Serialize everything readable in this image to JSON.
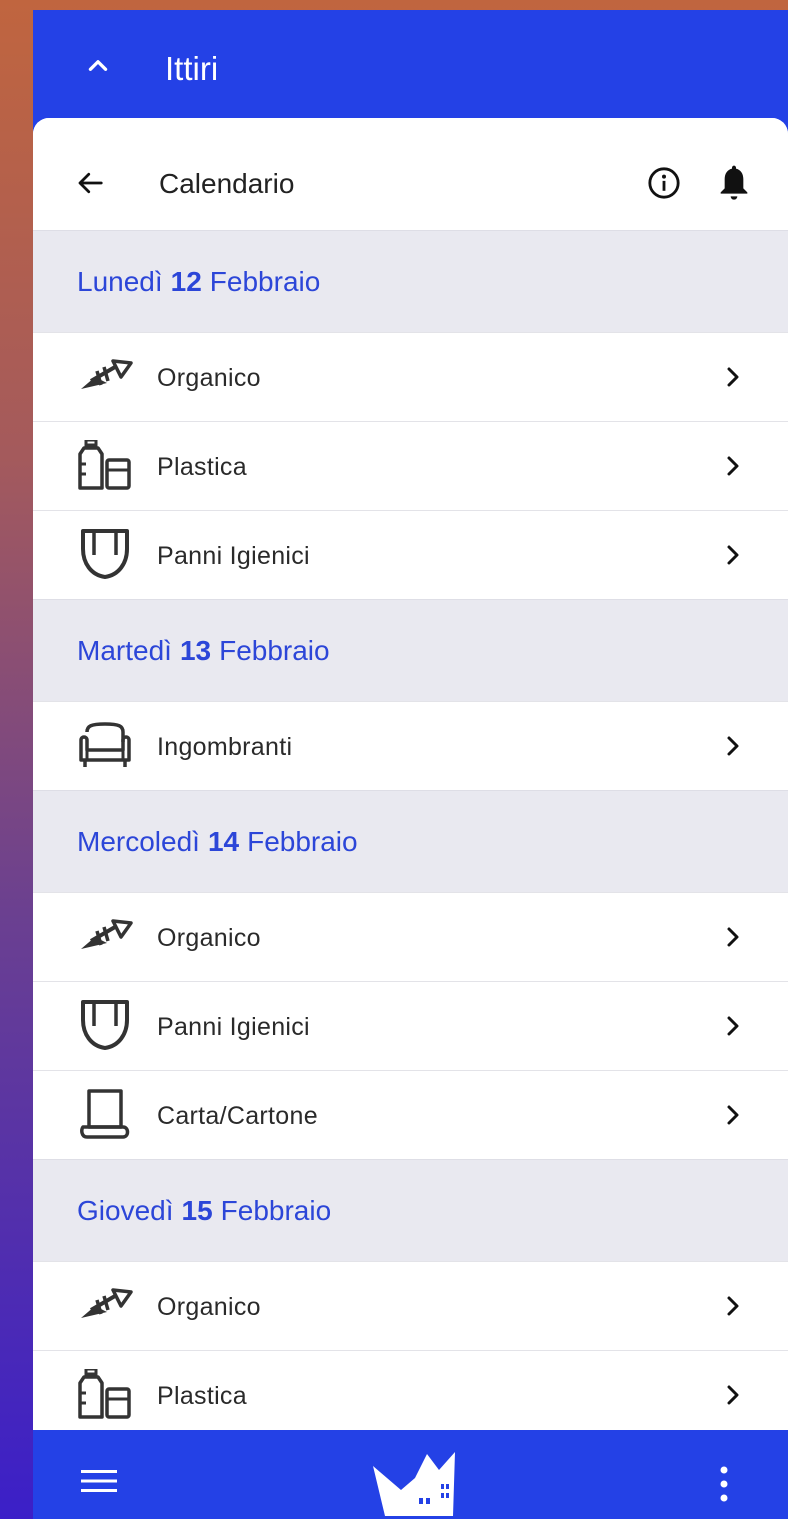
{
  "app": {
    "place_name": "Ittiri"
  },
  "header": {
    "title": "Calendario"
  },
  "days": [
    {
      "weekday": "Lunedì",
      "number": "12",
      "month": "Febbraio",
      "items": [
        {
          "label": "Organico",
          "icon": "fish-bone-icon"
        },
        {
          "label": "Plastica",
          "icon": "plastic-bottle-icon"
        },
        {
          "label": "Panni Igienici",
          "icon": "diaper-icon"
        }
      ]
    },
    {
      "weekday": "Martedì",
      "number": "13",
      "month": "Febbraio",
      "items": [
        {
          "label": "Ingombranti",
          "icon": "sofa-icon"
        }
      ]
    },
    {
      "weekday": "Mercoledì",
      "number": "14",
      "month": "Febbraio",
      "items": [
        {
          "label": "Organico",
          "icon": "fish-bone-icon"
        },
        {
          "label": "Panni Igienici",
          "icon": "diaper-icon"
        },
        {
          "label": "Carta/Cartone",
          "icon": "paper-scroll-icon"
        }
      ]
    },
    {
      "weekday": "Giovedì",
      "number": "15",
      "month": "Febbraio",
      "items": [
        {
          "label": "Organico",
          "icon": "fish-bone-icon"
        },
        {
          "label": "Plastica",
          "icon": "plastic-bottle-icon"
        }
      ]
    }
  ],
  "colors": {
    "primary": "#2441e6",
    "day_text": "#2c46d8",
    "day_bg": "#e9e9f0"
  }
}
